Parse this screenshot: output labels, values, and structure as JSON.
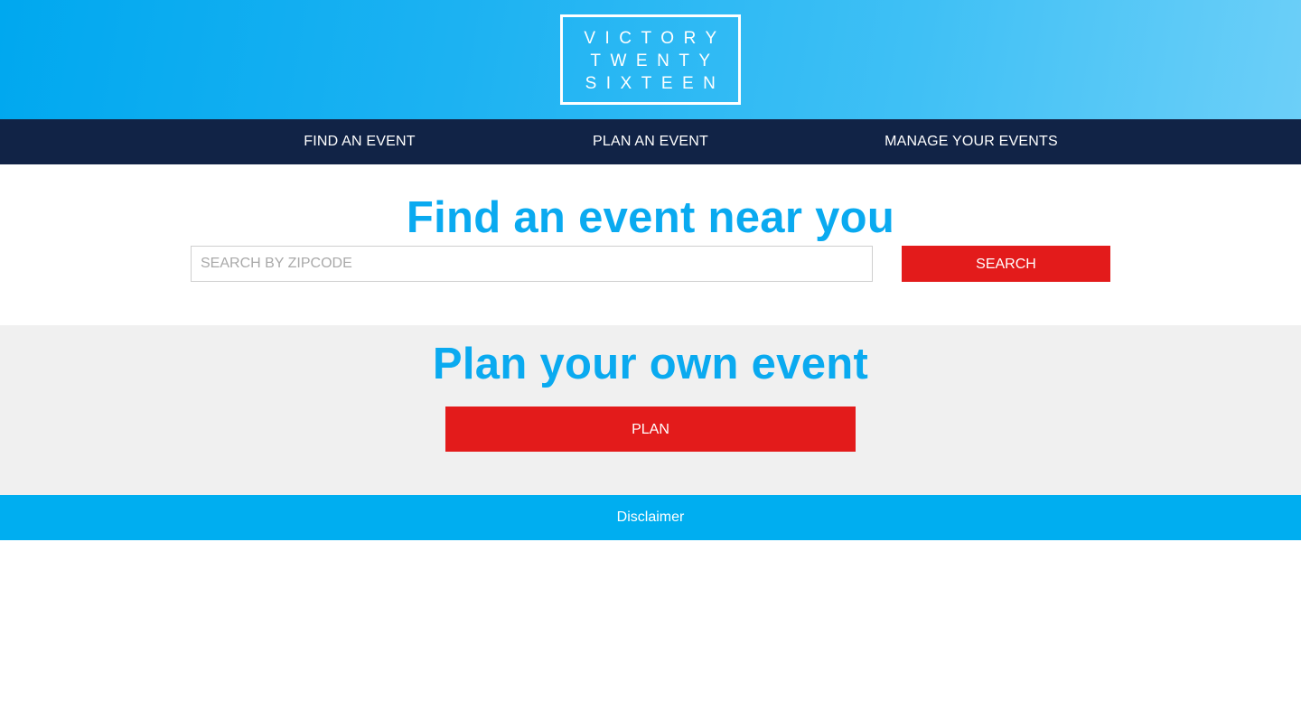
{
  "colors": {
    "header_gradient_start": "#00a8ef",
    "header_gradient_end": "#6ccff8",
    "nav_background": "#112346",
    "title_blue": "#0aaaf0",
    "button_red": "#e31b1b",
    "plan_background": "#f0f0f0",
    "footer_background": "#00aef0"
  },
  "logo": {
    "line1": "VICTORY",
    "line2": "TWENTY",
    "line3": "SIXTEEN"
  },
  "nav": {
    "find": "FIND AN EVENT",
    "plan": "PLAN AN EVENT",
    "manage": "MANAGE YOUR EVENTS"
  },
  "find": {
    "title": "Find an event near you",
    "placeholder": "SEARCH BY ZIPCODE",
    "value": "",
    "button": "SEARCH"
  },
  "plan": {
    "title": "Plan your own event",
    "button": "PLAN"
  },
  "footer": {
    "disclaimer": "Disclaimer"
  }
}
